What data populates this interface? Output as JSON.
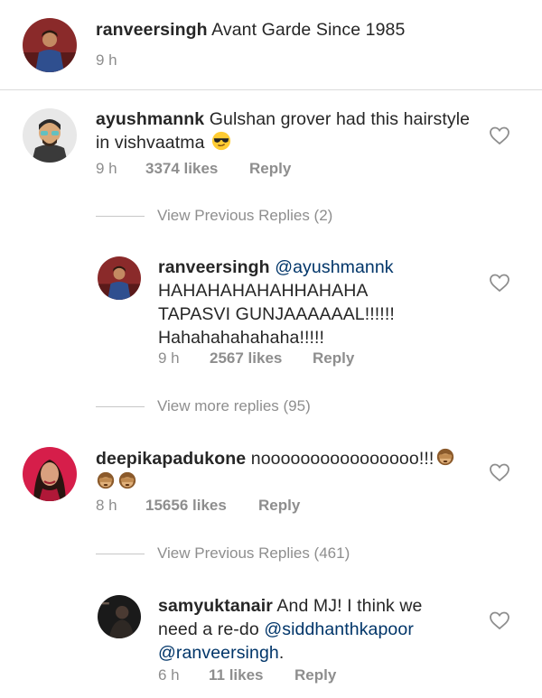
{
  "caption": {
    "username": "ranveersingh",
    "text": "Avant Garde Since 1985",
    "time": "9 h"
  },
  "comments": [
    {
      "username": "ayushmannk",
      "text_line1": "Gulshan grover had this hairstyle",
      "text_line2": "in vishvaatma",
      "emoji": "sunglasses-face-emoji",
      "time": "9 h",
      "likes": "3374 likes",
      "reply_label": "Reply",
      "view_replies": "View Previous Replies (2)",
      "reply": {
        "username": "ranveersingh",
        "mention": "@ayushmannk",
        "line2": "HAHAHAHAHAHHAHAHA",
        "line3": "TAPASVI GUNJAAAAAAL!!!!!!",
        "line4": "Hahahahahahaha!!!!!",
        "time": "9 h",
        "likes": "2567 likes",
        "reply_label": "Reply"
      },
      "view_more": "View more replies (95)"
    },
    {
      "username": "deepikapadukone",
      "text": "noooooooooooooooo!!!",
      "emoji": "see-no-evil-monkey-emoji",
      "time": "8 h",
      "likes": "15656 likes",
      "reply_label": "Reply",
      "view_replies": "View Previous Replies (461)",
      "reply": {
        "username": "samyuktanair",
        "text_line1": "And MJ! I think we",
        "text_line2": "need a re-do",
        "mention1": "@siddhanthkapoor",
        "mention2": "@ranveersingh",
        "period": ".",
        "time": "6 h",
        "likes": "11 likes",
        "reply_label": "Reply"
      }
    }
  ],
  "colors": {
    "text": "#262626",
    "muted": "#8e8e8e",
    "mention": "#003569",
    "divider": "#dbdbdb"
  }
}
